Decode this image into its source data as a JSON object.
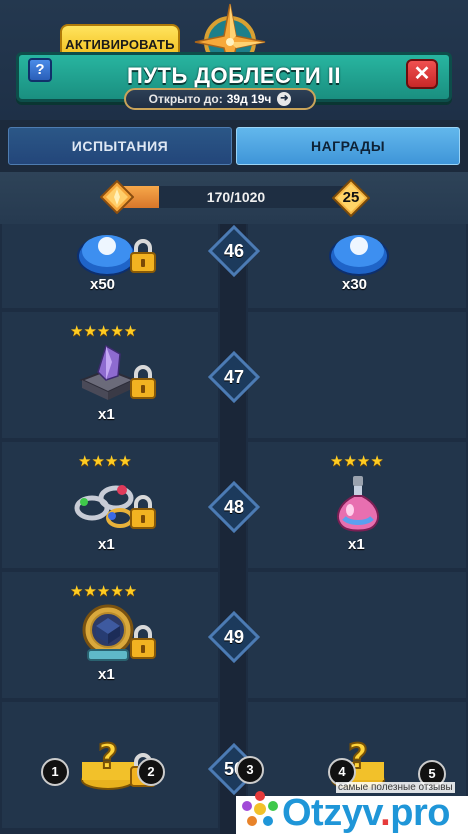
{
  "header": {
    "activate_label": "АКТИВИРОВАТЬ",
    "title": "ПУТЬ ДОБЛЕСТИ II",
    "help_label": "?",
    "close_label": "✕",
    "timer_label": "Открыто до:",
    "timer_value": "39д 19ч",
    "timer_icon": "clock-icon"
  },
  "tabs": [
    {
      "label": "ИСПЫТАНИЯ",
      "active": false
    },
    {
      "label": "НАГРАДЫ",
      "active": true
    }
  ],
  "progress": {
    "text": "170/1020",
    "value": 170,
    "max": 1020,
    "level": "25",
    "fill_color": "#e58c35"
  },
  "rows": [
    {
      "level": "46",
      "left": {
        "item": "blue-token",
        "stars": "",
        "qty": "x50",
        "locked": true
      },
      "right": {
        "item": "blue-token",
        "stars": "",
        "qty": "x30",
        "locked": false
      }
    },
    {
      "level": "47",
      "left": {
        "item": "crystal-cube",
        "stars": "★★★★★",
        "qty": "x1",
        "locked": true
      },
      "right": null
    },
    {
      "level": "48",
      "left": {
        "item": "rings",
        "stars": "★★★★",
        "qty": "x1",
        "locked": true
      },
      "right": {
        "item": "pink-potion",
        "stars": "★★★★",
        "qty": "x1",
        "locked": false
      }
    },
    {
      "level": "49",
      "left": {
        "item": "gold-relic",
        "stars": "★★★★★",
        "qty": "x1",
        "locked": true
      },
      "right": null
    },
    {
      "level": "50",
      "left": {
        "item": "mystery-chest",
        "stars": "",
        "qty": "",
        "locked": true
      },
      "right": {
        "item": "mystery-chest",
        "stars": "",
        "qty": "",
        "locked": false
      }
    }
  ],
  "markers": [
    "1",
    "2",
    "3",
    "4",
    "5"
  ],
  "watermark": {
    "caption": "самые полезные отзывы",
    "logo_main": "Otzyv",
    "logo_accent": ".",
    "logo_end": "pro"
  }
}
